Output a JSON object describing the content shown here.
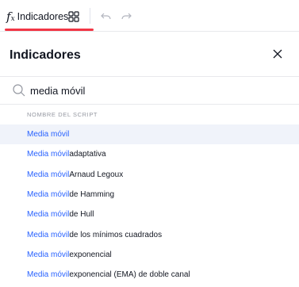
{
  "toolbar": {
    "indicators_label": "Indicadores",
    "fx_main": "f",
    "fx_sub": "x",
    "accent_color": "#f23645"
  },
  "dialog": {
    "title": "Indicadores",
    "close_icon": "close-icon",
    "search": {
      "value": "media móvil",
      "icon": "search-icon"
    },
    "section_header": "NOMBRE DEL SCRIPT",
    "highlight_color": "#2962ff",
    "results": [
      {
        "match": "Media móvil",
        "rest": "",
        "selected": true
      },
      {
        "match": "Media móvil",
        "rest": " adaptativa",
        "selected": false
      },
      {
        "match": "Media móvil",
        "rest": " Arnaud Legoux",
        "selected": false
      },
      {
        "match": "Media móvil",
        "rest": " de Hamming",
        "selected": false
      },
      {
        "match": "Media móvil",
        "rest": " de Hull",
        "selected": false
      },
      {
        "match": "Media móvil",
        "rest": " de los mínimos cuadrados",
        "selected": false
      },
      {
        "match": "Media móvil",
        "rest": " exponencial",
        "selected": false
      },
      {
        "match": "Media móvil",
        "rest": " exponencial (EMA) de doble canal",
        "selected": false
      }
    ]
  }
}
